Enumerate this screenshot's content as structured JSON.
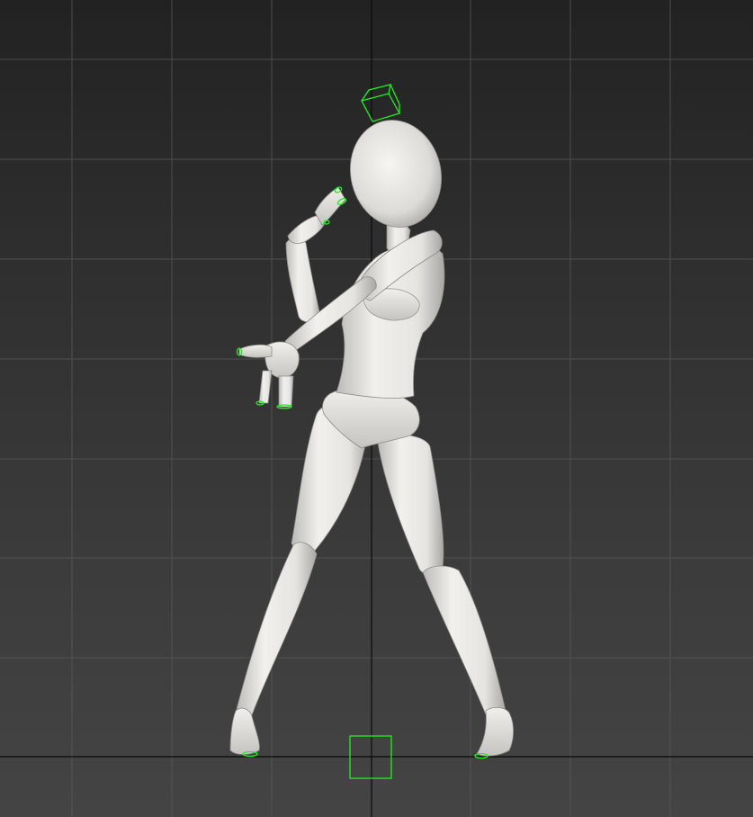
{
  "viewport": {
    "background_top": "#222222",
    "background_bottom": "#444444",
    "grid_color": "#5a5a5a",
    "axis_color": "#0a0a0a",
    "controller_color": "#22ee22",
    "model_color": "#e9e7e4"
  },
  "controls": [
    {
      "name": "head-controller",
      "icon": "cube-icon"
    },
    {
      "name": "root-controller",
      "icon": "square-icon"
    },
    {
      "name": "hand-ik-controls",
      "icon": "ring-icon"
    },
    {
      "name": "foot-ik-controls",
      "icon": "ring-icon"
    }
  ]
}
